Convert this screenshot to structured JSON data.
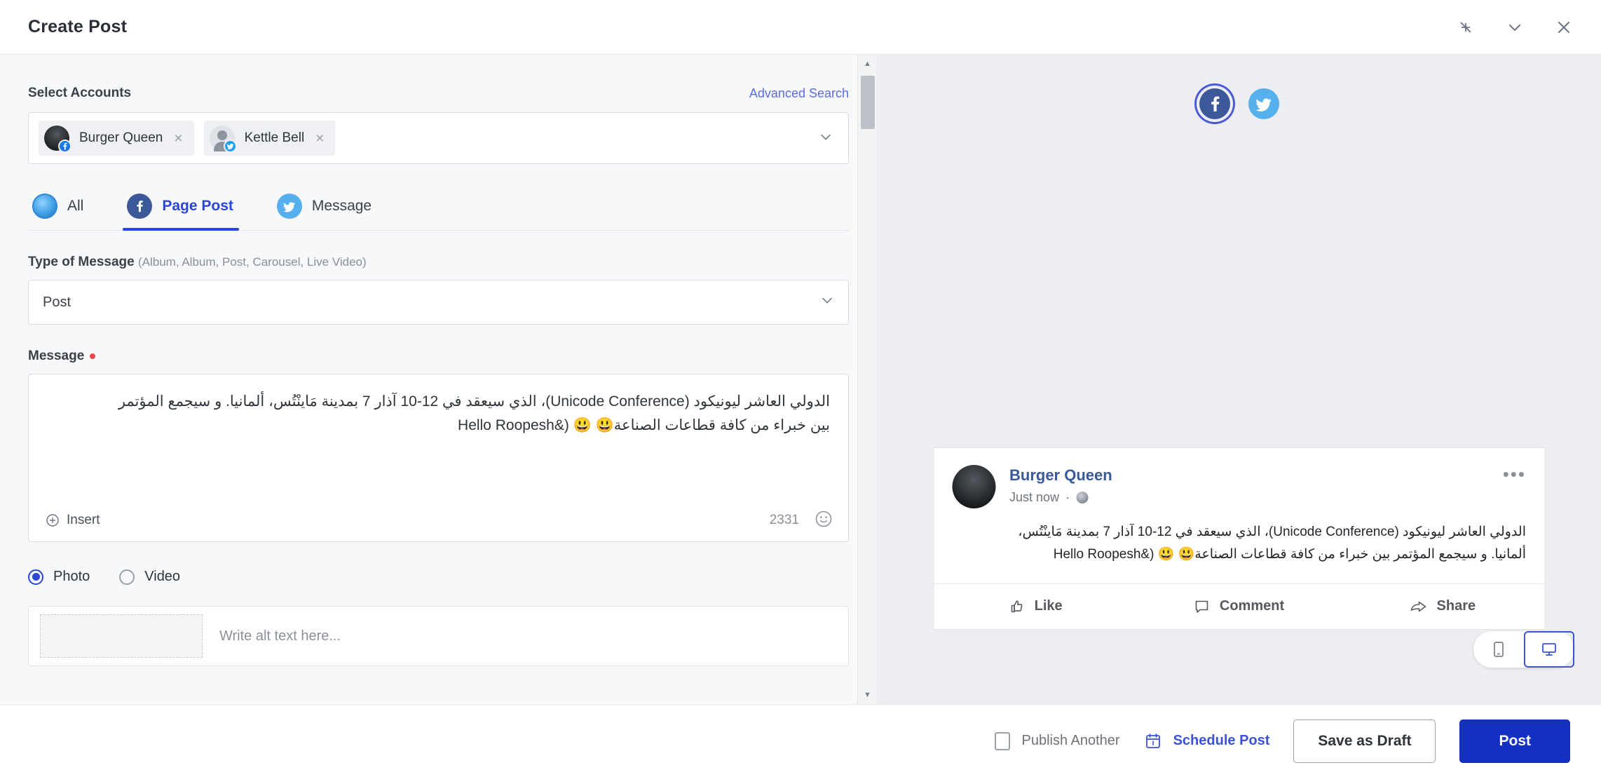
{
  "window": {
    "title": "Create Post",
    "actions": [
      {
        "name": "collapse-icon",
        "label": "Collapse"
      },
      {
        "name": "chevron-down-icon",
        "label": "Minimize"
      },
      {
        "name": "close-icon",
        "label": "Close"
      }
    ]
  },
  "form": {
    "select_accounts_label": "Select Accounts",
    "advanced_search_label": "Advanced Search",
    "accounts": [
      {
        "name": "Burger Queen",
        "network": "facebook",
        "remove": "×"
      },
      {
        "name": "Kettle Bell",
        "network": "twitter",
        "remove": "×"
      }
    ],
    "tabs": [
      {
        "id": "all",
        "label": "All",
        "icon": "globe-icon",
        "active": false
      },
      {
        "id": "page-post",
        "label": "Page Post",
        "icon": "facebook-icon",
        "active": true
      },
      {
        "id": "message",
        "label": "Message",
        "icon": "twitter-icon",
        "active": false
      }
    ],
    "type_of_message": {
      "label": "Type of Message",
      "hint": "(Album, Album, Post, Carousel, Live Video)",
      "value": "Post",
      "options": [
        "Album",
        "Album",
        "Post",
        "Carousel",
        "Live Video"
      ]
    },
    "message": {
      "label": "Message",
      "required": true,
      "line1": "الدولي العاشر ليونيكود (Unicode Conference)، الذي سيعقد في 12-10 آذار 7 بمدينة مَاينْتُس، ألمانيا. و سيجمع المؤتمر",
      "line2": "بين خبراء من كافة قطاعات الصناعة😃 😃 (&Hello Roopesh",
      "insert_label": "Insert",
      "character_count": "2331",
      "emoji_icon": "emoji-icon"
    },
    "media_type": {
      "selected": "Photo",
      "options": [
        {
          "id": "photo",
          "label": "Photo",
          "selected": true
        },
        {
          "id": "video",
          "label": "Video",
          "selected": false
        }
      ]
    },
    "alt_text_placeholder": "Write alt text here..."
  },
  "preview": {
    "network_icons": [
      {
        "name": "facebook-icon",
        "selected": true
      },
      {
        "name": "twitter-icon",
        "selected": false
      }
    ],
    "post": {
      "author": "Burger Queen",
      "time": "Just now",
      "separator": "·",
      "visibility_icon": "globe-icon",
      "menu": "•••",
      "text_line1": "الدولي العاشر ليونيكود (Unicode Conference)، الذي سيعقد في 12-10 آذار 7 بمدينة مَاينْتُس،",
      "text_line2": "ألمانيا. و سيجمع المؤتمر بين خبراء من كافة قطاعات الصناعة😃 😃 (&Hello Roopesh",
      "actions": [
        {
          "id": "like",
          "label": "Like",
          "icon": "thumbs-up-icon"
        },
        {
          "id": "comment",
          "label": "Comment",
          "icon": "comment-icon"
        },
        {
          "id": "share",
          "label": "Share",
          "icon": "share-icon"
        }
      ]
    },
    "device_toggle": [
      {
        "id": "mobile",
        "icon": "mobile-icon",
        "active": false
      },
      {
        "id": "desktop",
        "icon": "desktop-icon",
        "active": true
      }
    ]
  },
  "footer": {
    "publish_another_label": "Publish Another",
    "publish_another_checked": false,
    "schedule_post_label": "Schedule Post",
    "schedule_icon": "calendar-icon",
    "save_draft_label": "Save as Draft",
    "post_label": "Post"
  },
  "colors": {
    "primary": "#1430c4",
    "link": "#3b52d9",
    "facebook": "#3b5998",
    "twitter": "#57b0ee",
    "required": "#e5484d",
    "panel_bg": "#f7f8fa",
    "preview_bg": "#eceef1"
  }
}
